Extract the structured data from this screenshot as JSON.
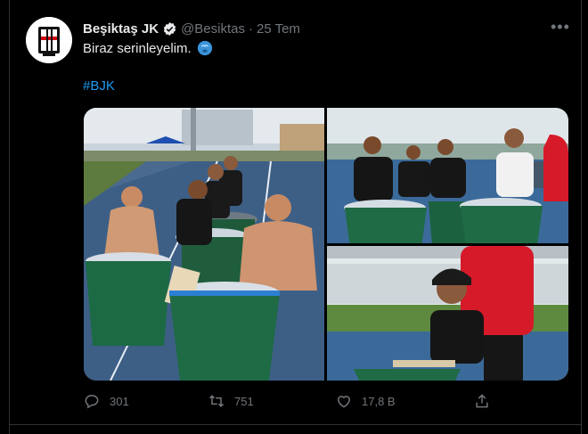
{
  "tweet": {
    "author_name": "Beşiktaş JK",
    "handle": "@Besiktas",
    "separator": "·",
    "date": "25 Tem",
    "text": "Biraz serinleyelim.",
    "hashtag": "#BJK"
  },
  "media": {
    "photos": [
      {
        "name": "ice-bath-photo-group"
      },
      {
        "name": "ice-bath-photo-training-kit"
      },
      {
        "name": "ice-bath-photo-red-shirt"
      }
    ]
  },
  "actions": {
    "replies": "301",
    "retweets": "751",
    "likes": "17,8 B"
  },
  "colors": {
    "background": "#000000",
    "text": "#e7e9ea",
    "muted": "#71767b",
    "accent": "#1d9bf0",
    "border": "#2f3336"
  },
  "icons": [
    "verified-icon",
    "more-icon",
    "emoji-icon",
    "reply-icon",
    "retweet-icon",
    "like-icon",
    "share-icon"
  ]
}
